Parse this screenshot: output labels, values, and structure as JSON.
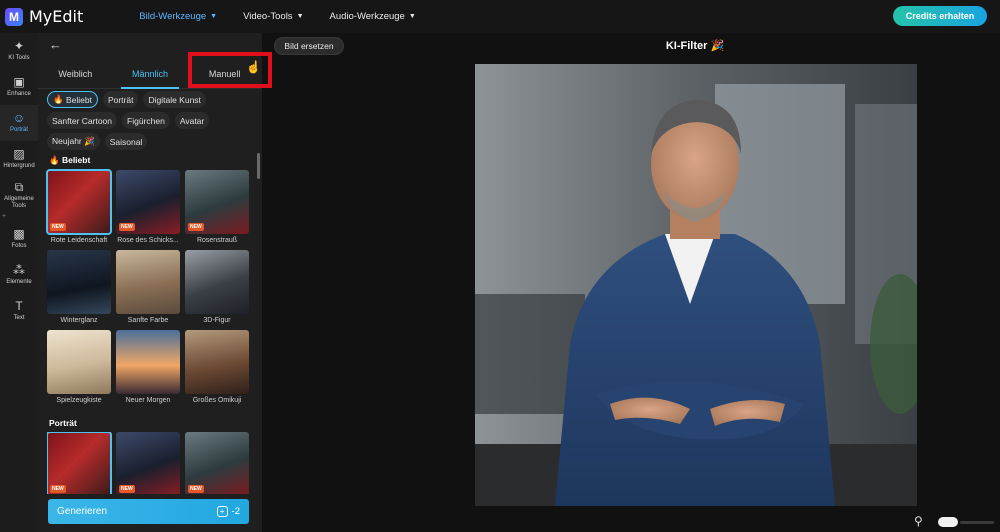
{
  "app": {
    "logo_letter": "M",
    "name": "MyEdit"
  },
  "nav": [
    {
      "label": "Bild-Werkzeuge",
      "active": true
    },
    {
      "label": "Video-Tools",
      "active": false
    },
    {
      "label": "Audio-Werkzeuge",
      "active": false
    }
  ],
  "credits_button": "Credits erhalten",
  "rail": [
    {
      "label": "KI Tools",
      "icon": "wand-icon"
    },
    {
      "label": "Enhance",
      "icon": "enhance-icon"
    },
    {
      "label": "Porträt",
      "icon": "portrait-icon"
    },
    {
      "label": "Hintergrund",
      "icon": "background-icon"
    },
    {
      "label": "Allgemeine Tools",
      "icon": "tools-icon"
    },
    {
      "label": "Fotos",
      "icon": "photo-icon"
    },
    {
      "label": "Elemente",
      "icon": "elements-icon"
    },
    {
      "label": "Text",
      "icon": "text-icon"
    }
  ],
  "panel": {
    "tabs": [
      "Weiblich",
      "Männlich",
      "Manuell"
    ],
    "chips": [
      "Beliebt",
      "Porträt",
      "Digitale Kunst",
      "Sanfter Cartoon",
      "Figürchen",
      "Avatar",
      "Neujahr 🎉",
      "Saisonal"
    ],
    "section_beliebt": "Beliebt",
    "beliebt_items": [
      {
        "label": "Rote Leidenschaft",
        "badge": "NEW"
      },
      {
        "label": "Rose des Schicks...",
        "badge": "NEW"
      },
      {
        "label": "Rosenstrauß",
        "badge": "NEW"
      },
      {
        "label": "Winterglanz",
        "badge": ""
      },
      {
        "label": "Sanfte Farbe",
        "badge": ""
      },
      {
        "label": "3D-Figur",
        "badge": ""
      },
      {
        "label": "Spielzeugkiste",
        "badge": ""
      },
      {
        "label": "Neuer Morgen",
        "badge": ""
      },
      {
        "label": "Großes Omikuji",
        "badge": ""
      }
    ],
    "section_portrait": "Porträt",
    "portrait_items": [
      {
        "label": "",
        "badge": "NEW"
      },
      {
        "label": "",
        "badge": "NEW"
      },
      {
        "label": "",
        "badge": "NEW"
      }
    ],
    "generate_label": "Generieren",
    "generate_cost": "-2"
  },
  "canvas": {
    "replace_button": "Bild ersetzen",
    "title": "KI-Filter 🎉"
  },
  "colors": {
    "accent": "#4fc1f2",
    "highlight": "#e10f1c",
    "badge": "#e4582a"
  }
}
